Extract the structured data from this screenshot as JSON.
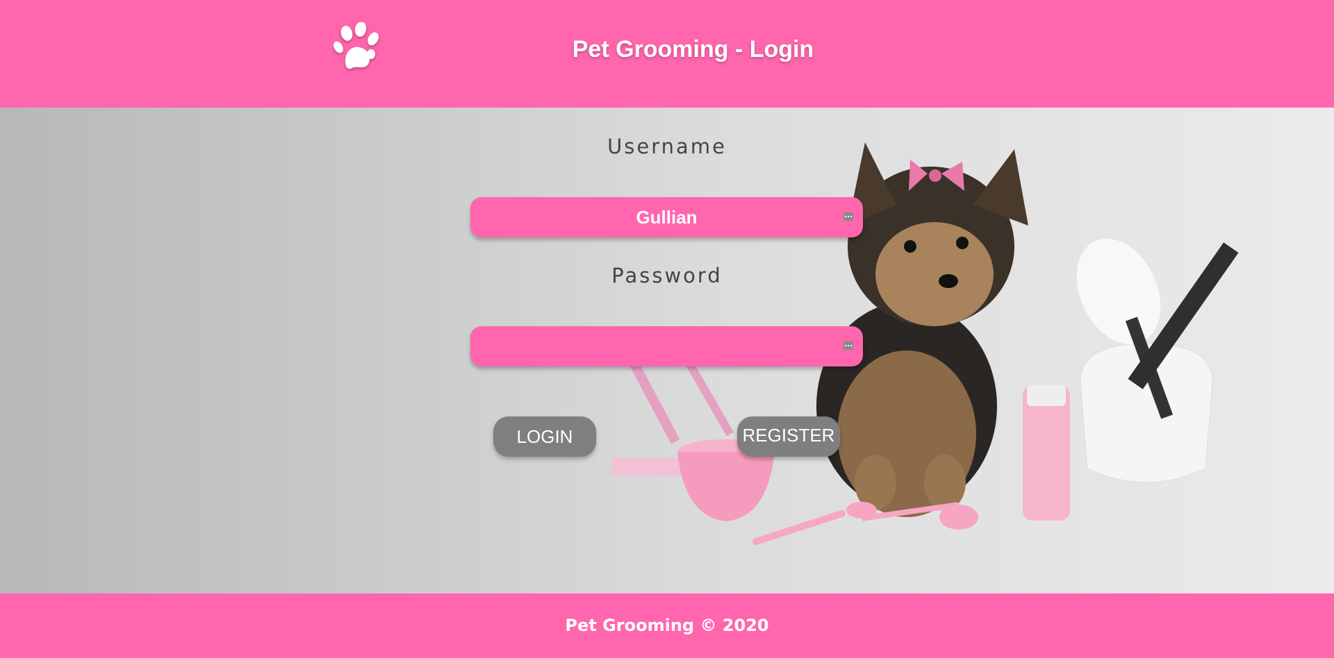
{
  "header": {
    "title": "Pet Grooming - Login",
    "logo_icon": "paw-icon"
  },
  "form": {
    "username_label": "Username",
    "username_value": "Gullian",
    "password_label": "Password",
    "password_value": "",
    "login_label": "LOGIN",
    "register_label": "REGISTER"
  },
  "footer": {
    "text": "Pet Grooming © 2020"
  },
  "colors": {
    "brand_pink": "#ff66ad",
    "button_gray": "#7f7f7f"
  }
}
